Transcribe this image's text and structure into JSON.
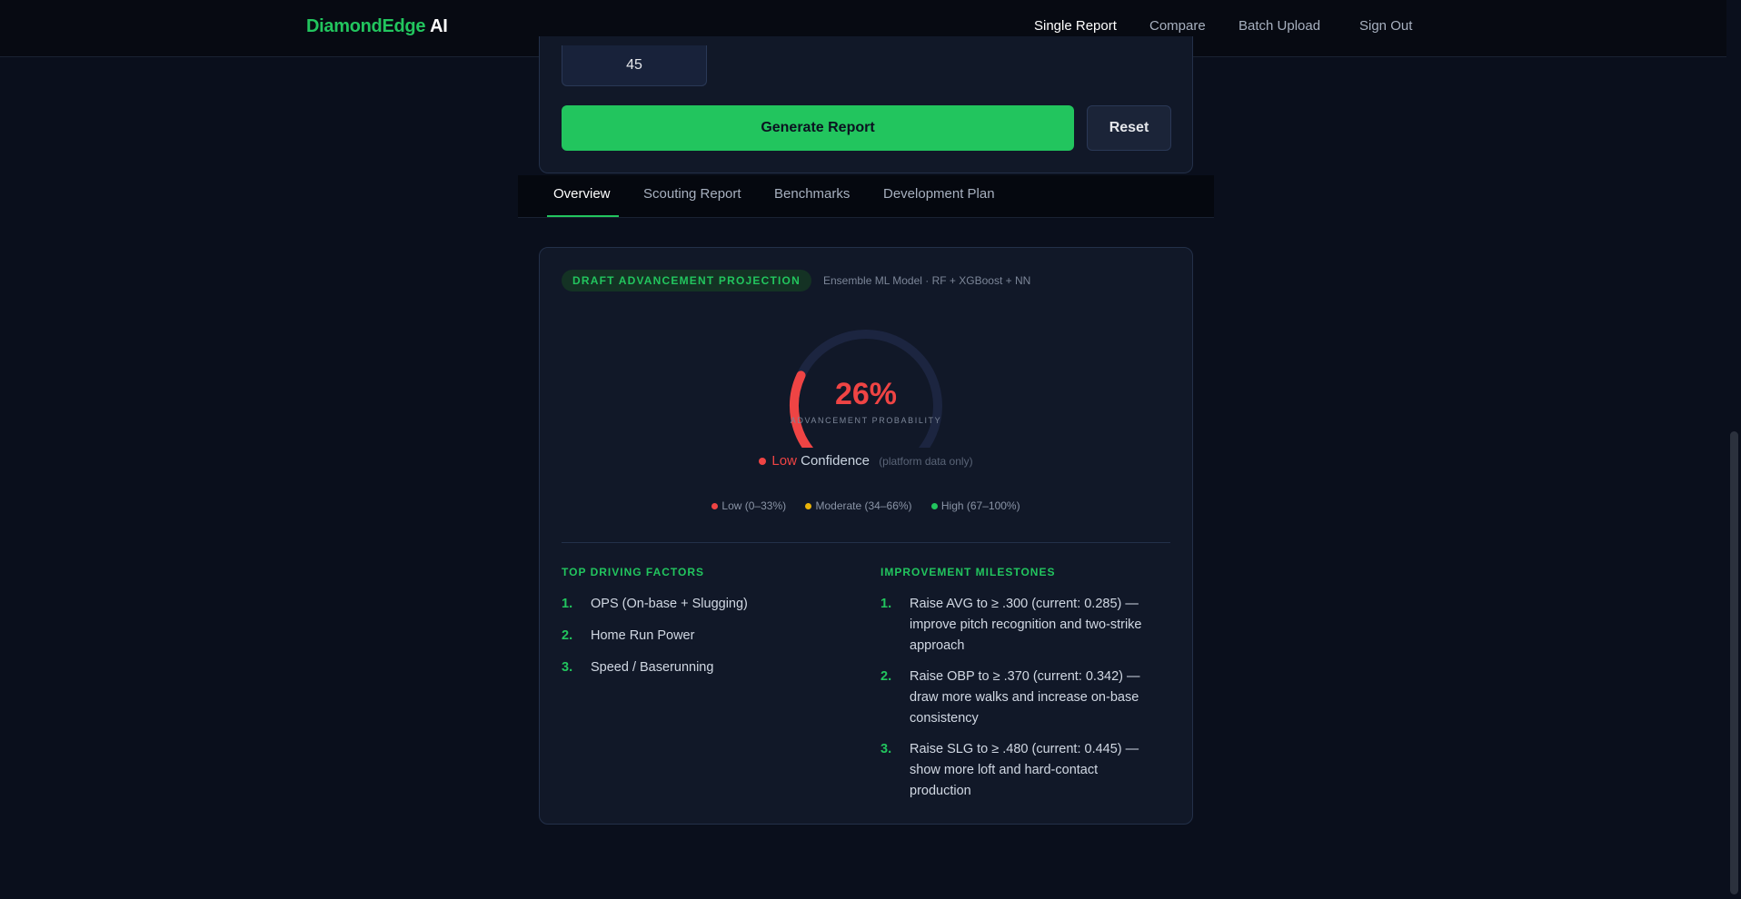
{
  "app": {
    "brand_primary": "DiamondEdge",
    "brand_secondary": "AI"
  },
  "nav": {
    "single_report": "Single Report",
    "compare": "Compare",
    "batch_upload": "Batch Upload",
    "sign_out": "Sign Out"
  },
  "form": {
    "number_value": "45",
    "generate_label": "Generate Report",
    "reset_label": "Reset"
  },
  "tabs": {
    "overview": "Overview",
    "scouting_report": "Scouting Report",
    "benchmarks": "Benchmarks",
    "development_plan": "Development Plan"
  },
  "projection": {
    "pill": "DRAFT ADVANCEMENT PROJECTION",
    "model": "Ensemble ML Model · RF + XGBoost + NN",
    "percent_display": "26%",
    "probability": 0.26,
    "caption": "ADVANCEMENT PROBABILITY",
    "confidence_level": "Low",
    "confidence_word": "Confidence",
    "confidence_note": "(platform data only)",
    "legend": {
      "low": "Low (0–33%)",
      "moderate": "Moderate (34–66%)",
      "high": "High (67–100%)"
    },
    "colors": {
      "low": "#ef4444",
      "moderate": "#eab308",
      "high": "#22c55e",
      "track": "#1c2540"
    }
  },
  "factors": {
    "title": "TOP DRIVING FACTORS",
    "items": [
      {
        "num": "1.",
        "text": "OPS (On-base + Slugging)"
      },
      {
        "num": "2.",
        "text": "Home Run Power"
      },
      {
        "num": "3.",
        "text": "Speed / Baserunning"
      }
    ]
  },
  "milestones": {
    "title": "IMPROVEMENT MILESTONES",
    "items": [
      {
        "num": "1.",
        "text": "Raise AVG to ≥ .300 (current: 0.285) — improve pitch recognition and two-strike approach"
      },
      {
        "num": "2.",
        "text": "Raise OBP to ≥ .370 (current: 0.342) — draw more walks and increase on-base consistency"
      },
      {
        "num": "3.",
        "text": "Raise SLG to ≥ .480 (current: 0.445) — show more loft and hard-contact production"
      }
    ]
  },
  "theme": {
    "accent": "#22c55e",
    "background": "#0a0f1c",
    "card": "#111828"
  }
}
